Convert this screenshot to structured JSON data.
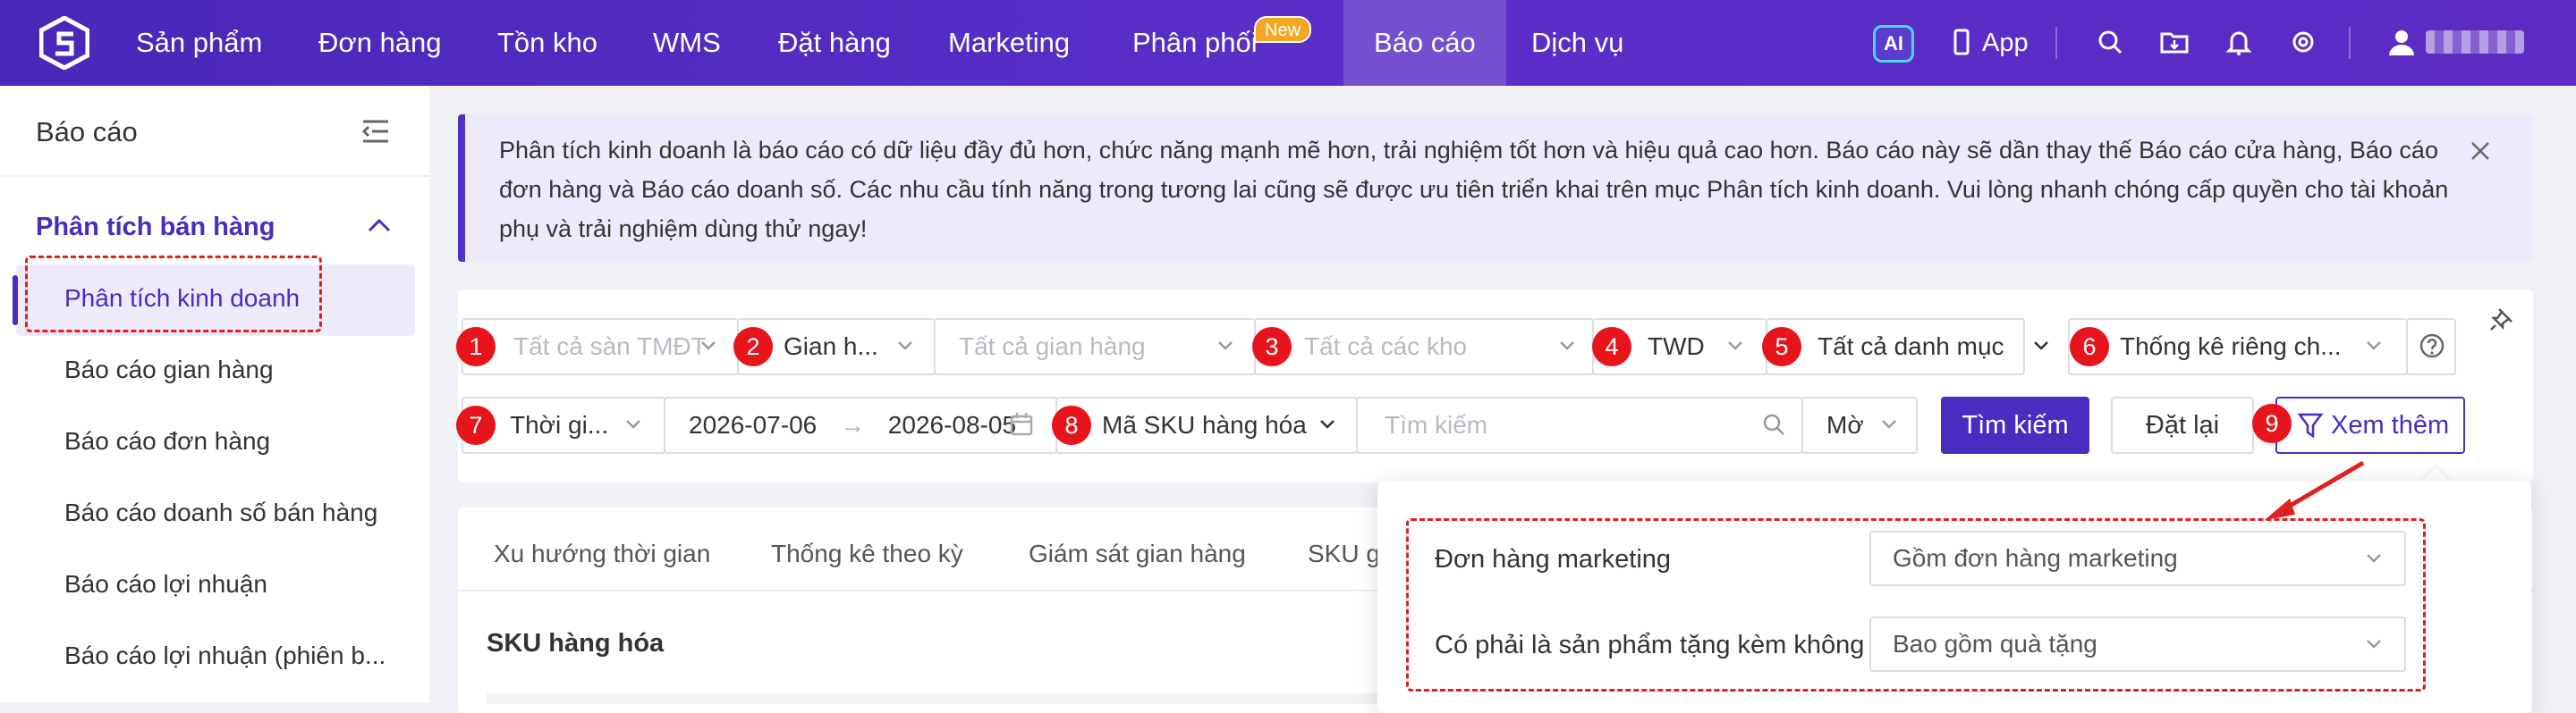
{
  "topnav": {
    "items": [
      "Sản phẩm",
      "Đơn hàng",
      "Tồn kho",
      "WMS",
      "Đặt hàng",
      "Marketing",
      "Phân phối",
      "Báo cáo",
      "Dịch vụ"
    ],
    "new_badge": "New",
    "ai_label": "AI",
    "app_label": "App",
    "accent": "#5a2fc8"
  },
  "sidebar": {
    "title": "Báo cáo",
    "group": "Phân tích bán hàng",
    "items": [
      "Phân tích kinh doanh",
      "Báo cáo gian hàng",
      "Báo cáo đơn hàng",
      "Báo cáo doanh số bán hàng",
      "Báo cáo lợi nhuận",
      "Báo cáo lợi nhuận (phiên b..."
    ]
  },
  "notice": {
    "text": "Phân tích kinh doanh là báo cáo có dữ liệu đầy đủ hơn, chức năng mạnh mẽ hơn, trải nghiệm tốt hơn và hiệu quả cao hơn. Báo cáo này sẽ dần thay thế Báo cáo cửa hàng, Báo cáo đơn hàng và Báo cáo doanh số. Các nhu cầu tính năng trong tương lai cũng sẽ được ưu tiên triển khai trên mục Phân tích kinh doanh. Vui lòng nhanh chóng cấp quyền cho tài khoản phụ và trải nghiệm dùng thử ngay!"
  },
  "filters": {
    "numbers": [
      "1",
      "2",
      "3",
      "4",
      "5",
      "6",
      "7",
      "8",
      "9"
    ],
    "platform_placeholder": "Tất cả sàn TMĐT",
    "shop_type": "Gian h...",
    "shop_placeholder": "Tất cả gian hàng",
    "warehouse_placeholder": "Tất cả các kho",
    "currency": "TWD",
    "category": "Tất cả danh mục",
    "stat_mode": "Thống kê riêng ch...",
    "time_type": "Thời gi...",
    "date_from": "2026-07-06",
    "date_sep": "→",
    "date_to": "2026-08-05",
    "sku_type": "Mã SKU hàng hóa",
    "search_placeholder": "Tìm kiếm",
    "match_mode": "Mờ",
    "search_button": "Tìm kiếm",
    "reset_button": "Đặt lại",
    "more_button": "Xem thêm"
  },
  "tabs": [
    "Xu hướng thời gian",
    "Thống kê theo kỳ",
    "Giám sát gian hàng",
    "SKU gi"
  ],
  "section_title": "SKU hàng hóa",
  "popover": {
    "rows": [
      {
        "label": "Đơn hàng marketing",
        "value": "Gồm đơn hàng marketing"
      },
      {
        "label": "Có phải là sản phẩm tặng kèm không",
        "value": "Bao gồm quà tặng"
      }
    ]
  }
}
